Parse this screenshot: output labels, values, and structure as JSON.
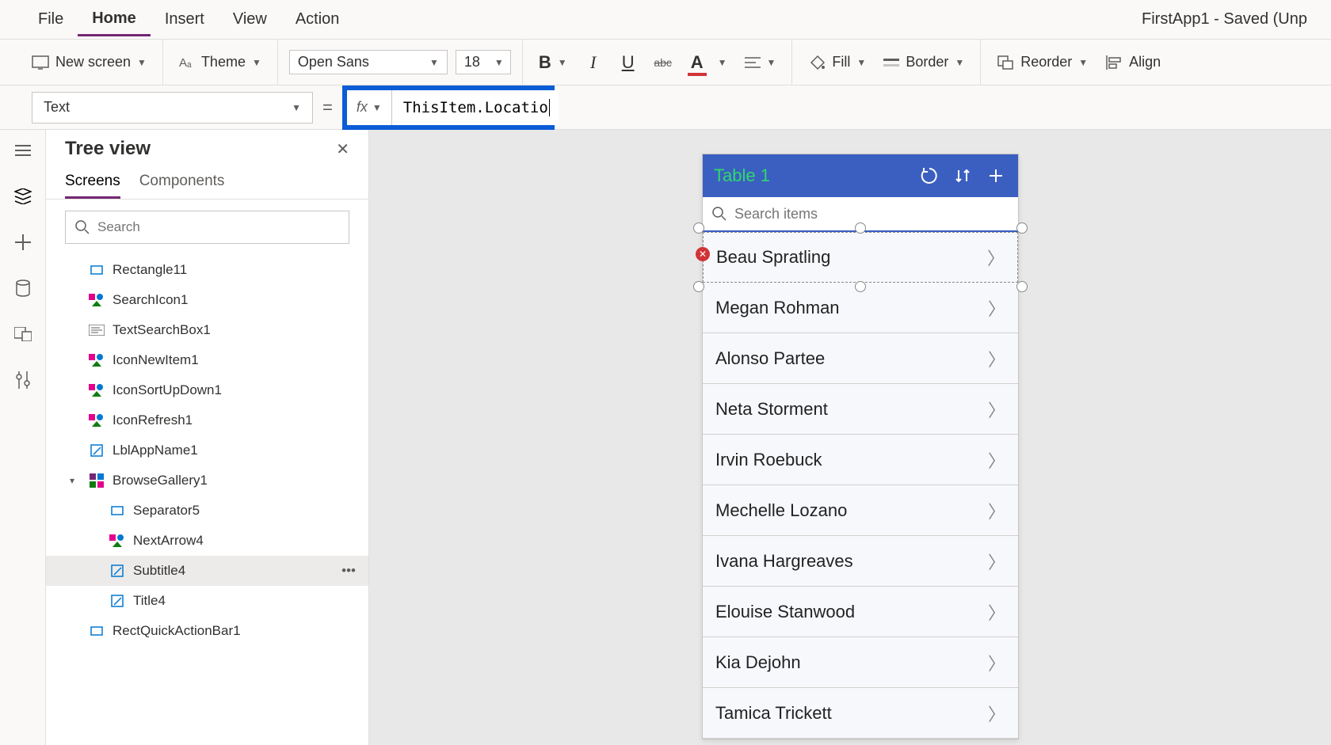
{
  "doc_title": "FirstApp1 - Saved (Unp",
  "menubar": [
    "File",
    "Home",
    "Insert",
    "View",
    "Action"
  ],
  "menubar_active": "Home",
  "ribbon": {
    "new_screen": "New screen",
    "theme": "Theme",
    "font_family": "Open Sans",
    "font_size": "18",
    "fill": "Fill",
    "border": "Border",
    "reorder": "Reorder",
    "align": "Align"
  },
  "formula": {
    "property": "Text",
    "fx": "fx",
    "value": "ThisItem.Location"
  },
  "tree": {
    "title": "Tree view",
    "tabs": [
      "Screens",
      "Components"
    ],
    "active_tab": "Screens",
    "search_placeholder": "Search",
    "items": [
      {
        "label": "Rectangle11",
        "icon": "rect",
        "indent": 0
      },
      {
        "label": "SearchIcon1",
        "icon": "group",
        "indent": 0
      },
      {
        "label": "TextSearchBox1",
        "icon": "textbox",
        "indent": 0
      },
      {
        "label": "IconNewItem1",
        "icon": "group",
        "indent": 0
      },
      {
        "label": "IconSortUpDown1",
        "icon": "group",
        "indent": 0
      },
      {
        "label": "IconRefresh1",
        "icon": "group",
        "indent": 0
      },
      {
        "label": "LblAppName1",
        "icon": "label",
        "indent": 0
      },
      {
        "label": "BrowseGallery1",
        "icon": "gallery",
        "indent": 0,
        "expandable": true,
        "expanded": true
      },
      {
        "label": "Separator5",
        "icon": "rect",
        "indent": 1
      },
      {
        "label": "NextArrow4",
        "icon": "group",
        "indent": 1
      },
      {
        "label": "Subtitle4",
        "icon": "label",
        "indent": 1,
        "selected": true,
        "more": true
      },
      {
        "label": "Title4",
        "icon": "label",
        "indent": 1
      },
      {
        "label": "RectQuickActionBar1",
        "icon": "rect",
        "indent": 0
      }
    ]
  },
  "phone": {
    "title": "Table 1",
    "search_placeholder": "Search items",
    "items": [
      "Beau Spratling",
      "Megan Rohman",
      "Alonso Partee",
      "Neta Storment",
      "Irvin Roebuck",
      "Mechelle Lozano",
      "Ivana Hargreaves",
      "Elouise Stanwood",
      "Kia Dejohn",
      "Tamica Trickett"
    ]
  }
}
